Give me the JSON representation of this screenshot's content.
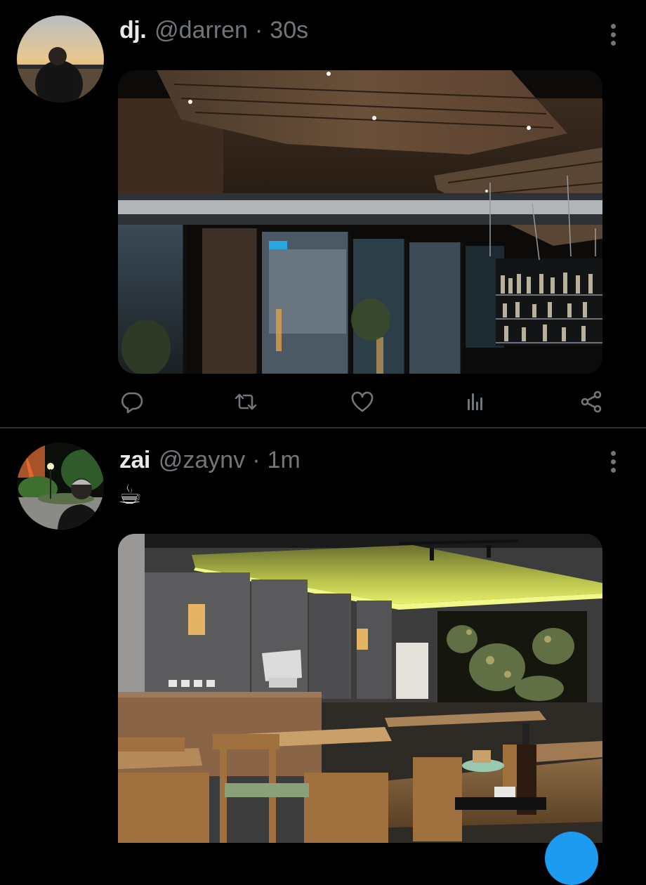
{
  "colors": {
    "background": "#000000",
    "text_primary": "#e7e9ea",
    "text_secondary": "#71767b",
    "divider": "#2f3336",
    "accent": "#1d9bf0"
  },
  "tweets": [
    {
      "display_name": "dj.",
      "handle": "@darren",
      "separator": "·",
      "time": "30s",
      "text": "",
      "media_description": "restaurant-exterior-night-photo",
      "actions": [
        "reply-icon",
        "retweet-icon",
        "like-icon",
        "views-icon",
        "share-icon"
      ]
    },
    {
      "display_name": "zai",
      "handle": "@zaynv",
      "separator": "·",
      "time": "1m",
      "text": "☕",
      "media_description": "restaurant-interior-photo"
    }
  ],
  "icons": {
    "more": "more-options-icon",
    "compose": "compose-fab"
  }
}
